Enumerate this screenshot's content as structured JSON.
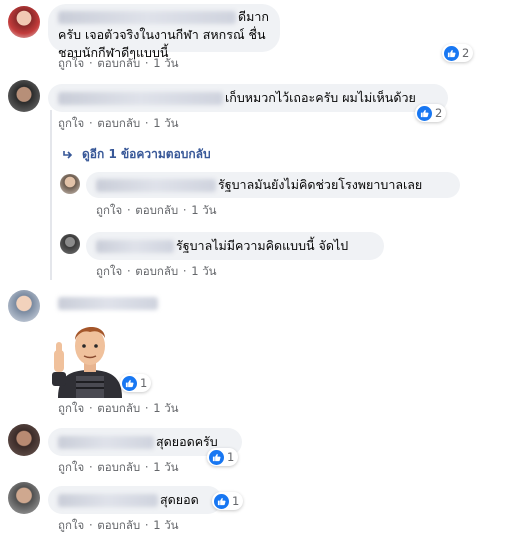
{
  "meta_labels": {
    "like": "ถูกใจ",
    "reply": "ตอบกลับ",
    "sep": "·",
    "time": "1 วัน"
  },
  "colors": {
    "link": "#385898",
    "like_blue": "#1877f2",
    "bubble": "#f0f2f5",
    "meta": "#65676b"
  },
  "comments": [
    {
      "text": "ดีมากครับ เจอตัวจริงในงานกีฬา สหกรณ์ ชื่นชอบนักกีฬาดีๆแบบนี้",
      "reactions": "2"
    },
    {
      "text": "เก็บหมวกไว้เถอะครับ ผมไม่เห็นด้วย",
      "reactions": "2"
    },
    {
      "text": "",
      "reactions": "1"
    },
    {
      "text": "สุดยอดครับ",
      "reactions": "1"
    },
    {
      "text": "สุดยอด",
      "reactions": "1"
    }
  ],
  "view_replies": "ดูอีก 1 ข้อความตอบกลับ",
  "replies": [
    {
      "text": "รัฐบาลมันยังไม่คิดช่วยโรงพยาบาลเลย"
    },
    {
      "text": "รัฐบาลไม่มีความคิดแบบนี้ จัดไป"
    }
  ]
}
